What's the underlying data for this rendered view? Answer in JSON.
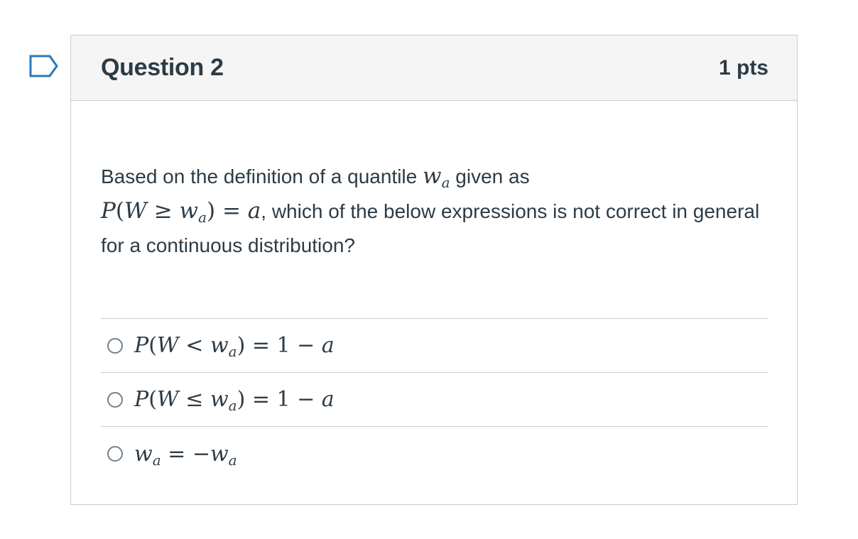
{
  "question": {
    "title": "Question 2",
    "points": "1 pts",
    "flag_icon": "flag-bookmark-icon",
    "text_part1": "Based on the definition of a quantile ",
    "text_part1_math": "w_a",
    "text_part2": " given as",
    "text_math2": "P(W ≥ w_a) = a",
    "text_part3": ", which of the below expressions is not correct in general for a continuous distribution?",
    "answers": [
      {
        "label": "P(W < w_a) = 1 − a",
        "selected": false
      },
      {
        "label": "P(W ≤ w_a) = 1 − a",
        "selected": false
      },
      {
        "label": "w_a = −w_a",
        "selected": false
      }
    ]
  }
}
